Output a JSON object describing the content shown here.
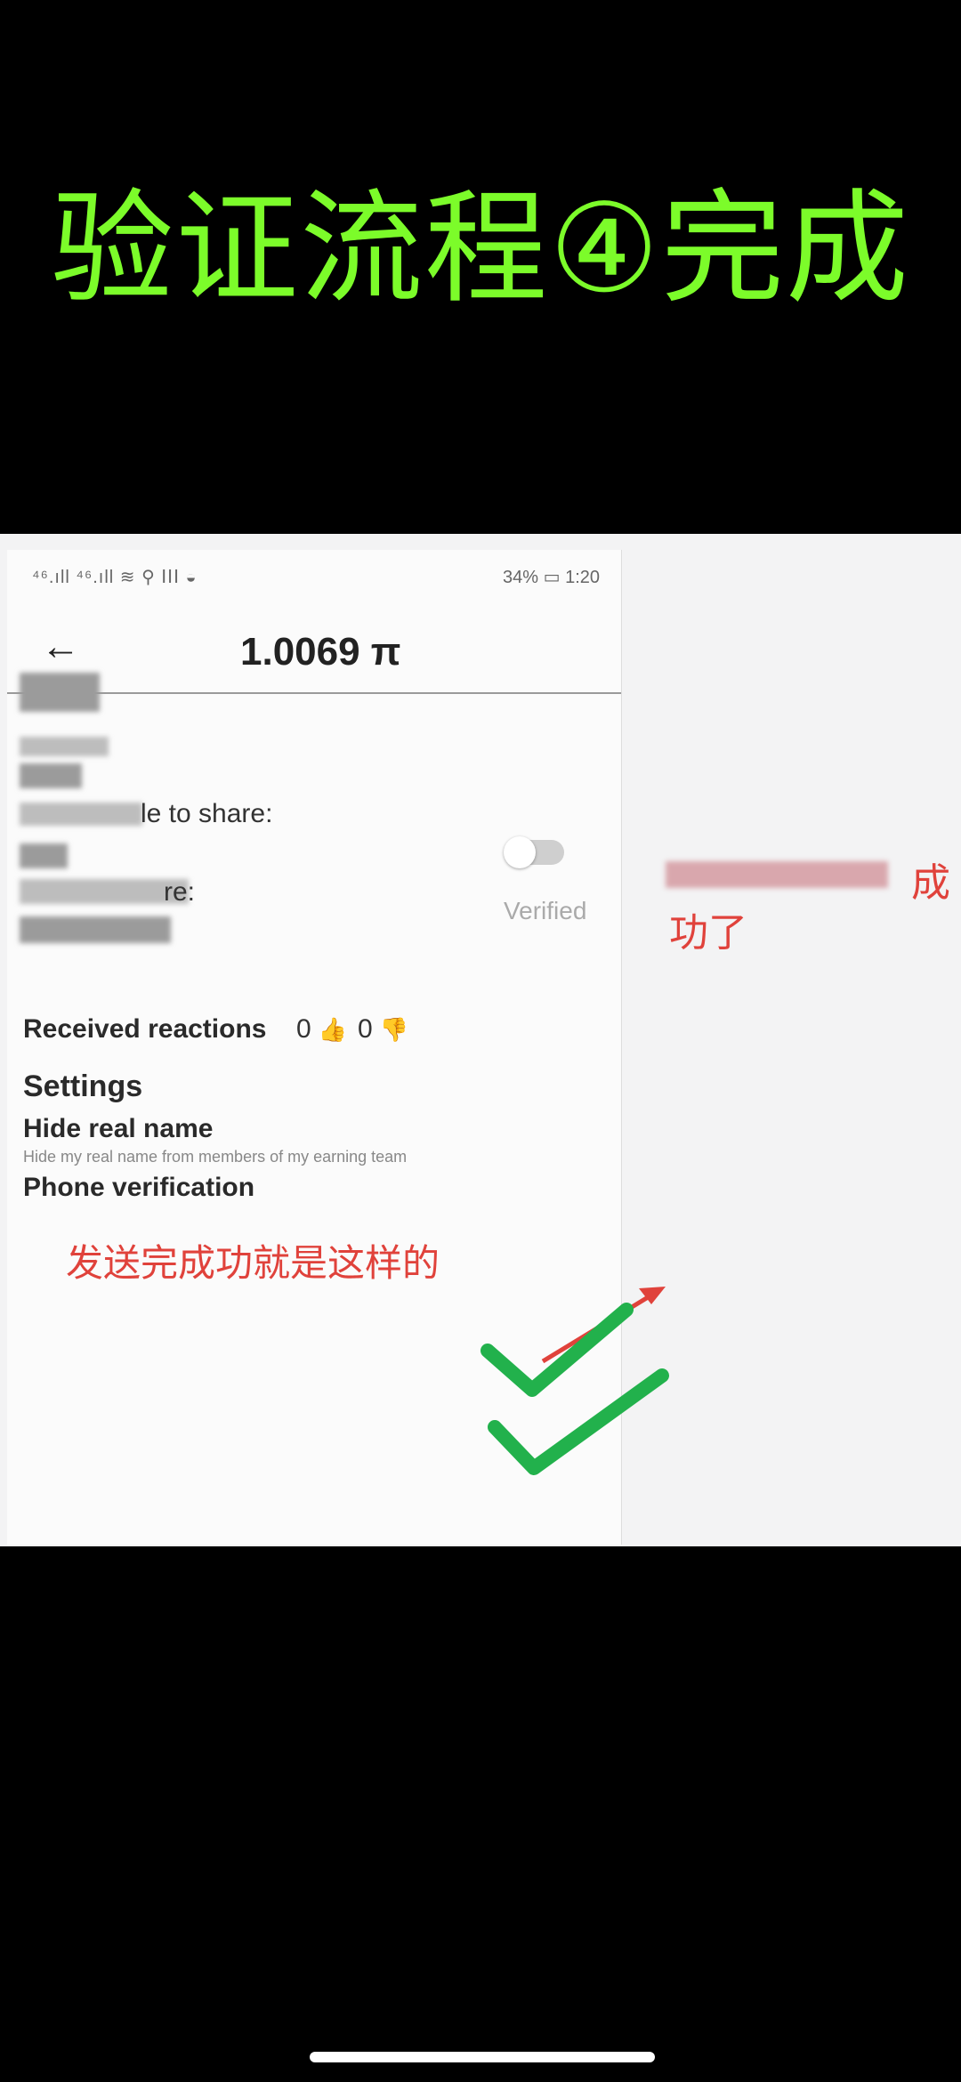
{
  "banner": {
    "title": "验证流程④完成"
  },
  "status_bar": {
    "left": "⁴⁶.ıll ⁴⁶.ıll ≋ ⚲ ⅠⅠⅠ ◒",
    "right": "34% ▭ 1:20"
  },
  "app_bar": {
    "back_icon": "←",
    "balance": "1.0069 π"
  },
  "profile": {
    "invitation_label": "le to share:",
    "referral_label": "re:"
  },
  "reactions": {
    "label": "Received reactions",
    "likes": "0",
    "dislikes": "0",
    "like_icon": "👍",
    "dislike_icon": "👎"
  },
  "settings": {
    "heading": "Settings",
    "hide_real_name": {
      "label": "Hide real name",
      "description": "Hide my real name from members of my earning team"
    },
    "phone_verification": {
      "label": "Phone verification",
      "status": "Verified"
    }
  },
  "annotations": {
    "right_note_1": "成",
    "right_note_2": "功了",
    "bottom_note": "发送完成功就是这样的",
    "colors": {
      "red": "#e0423b",
      "green": "#22b14c",
      "title_green": "#7CFC2A"
    }
  }
}
